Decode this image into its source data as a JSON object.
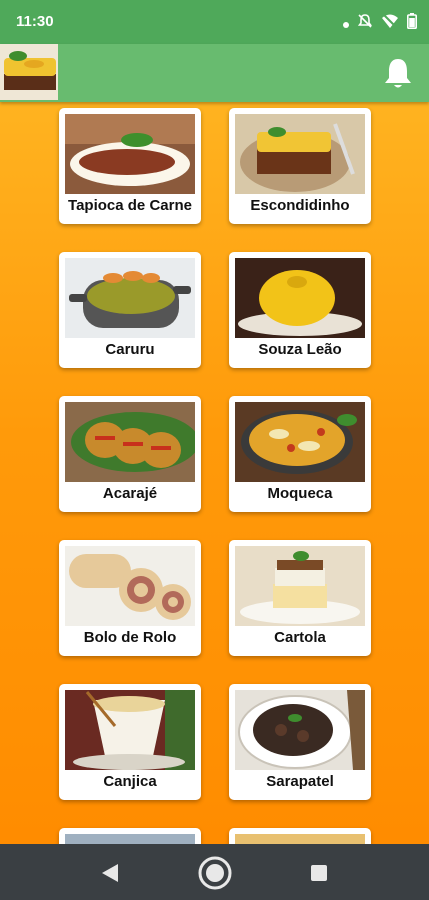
{
  "status": {
    "time": "11:30"
  },
  "app_bar": {
    "thumbnail_icon": "dish-thumbnail",
    "notification_icon": "bell-icon"
  },
  "colors": {
    "status_bar": "#4fa95a",
    "app_bar": "#68bb6f",
    "background": "#ff9a0a",
    "nav_bar": "#3a3f43"
  },
  "dishes": [
    {
      "label": "Tapioca de Carne"
    },
    {
      "label": "Escondidinho"
    },
    {
      "label": "Caruru"
    },
    {
      "label": "Souza Leão"
    },
    {
      "label": "Acarajé"
    },
    {
      "label": "Moqueca"
    },
    {
      "label": "Bolo de Rolo"
    },
    {
      "label": "Cartola"
    },
    {
      "label": "Canjica"
    },
    {
      "label": "Sarapatel"
    }
  ],
  "nav": {
    "back_icon": "back-triangle-icon",
    "home_icon": "home-circle-icon",
    "recents_icon": "recents-square-icon"
  }
}
